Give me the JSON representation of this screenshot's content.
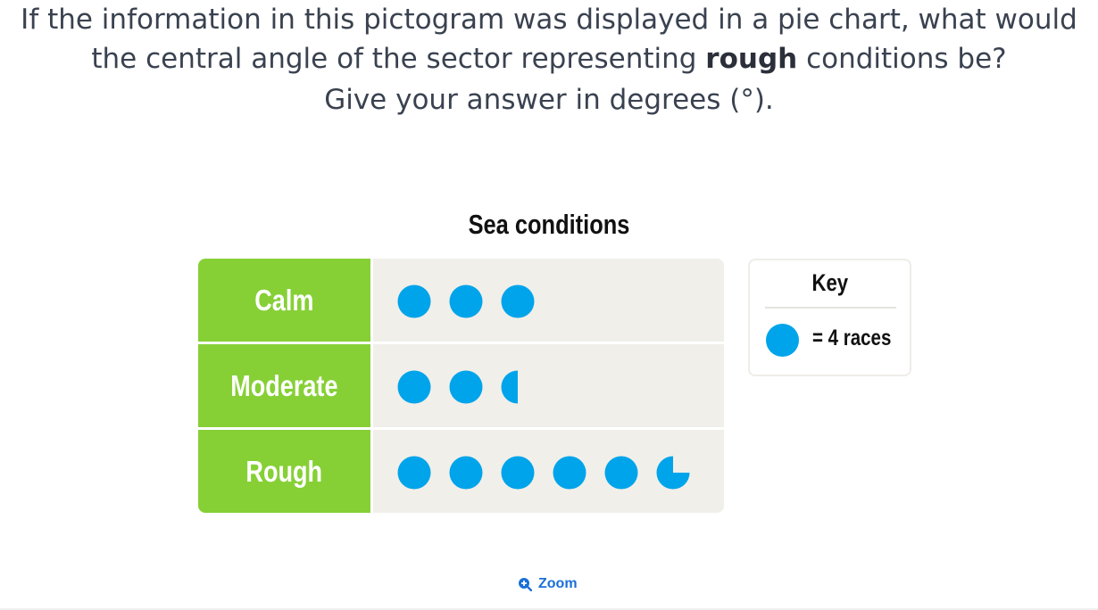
{
  "question": {
    "part1": "If the information in this pictogram was displayed in a pie chart, what would the central angle of the sector representing ",
    "bold_word": "rough",
    "part2": " conditions be?",
    "line2": "Give your answer in degrees (°)."
  },
  "chart_data": {
    "type": "pictogram",
    "title": "Sea conditions",
    "categories": [
      "Calm",
      "Moderate",
      "Rough"
    ],
    "icons": [
      3,
      2.5,
      5.75
    ],
    "values": [
      12,
      10,
      23
    ],
    "icon_value": 4,
    "icon_color": "#00a4ea",
    "label_color": "#86d036",
    "key": {
      "title": "Key",
      "text": "= 4 races"
    }
  },
  "zoom_label": "Zoom"
}
